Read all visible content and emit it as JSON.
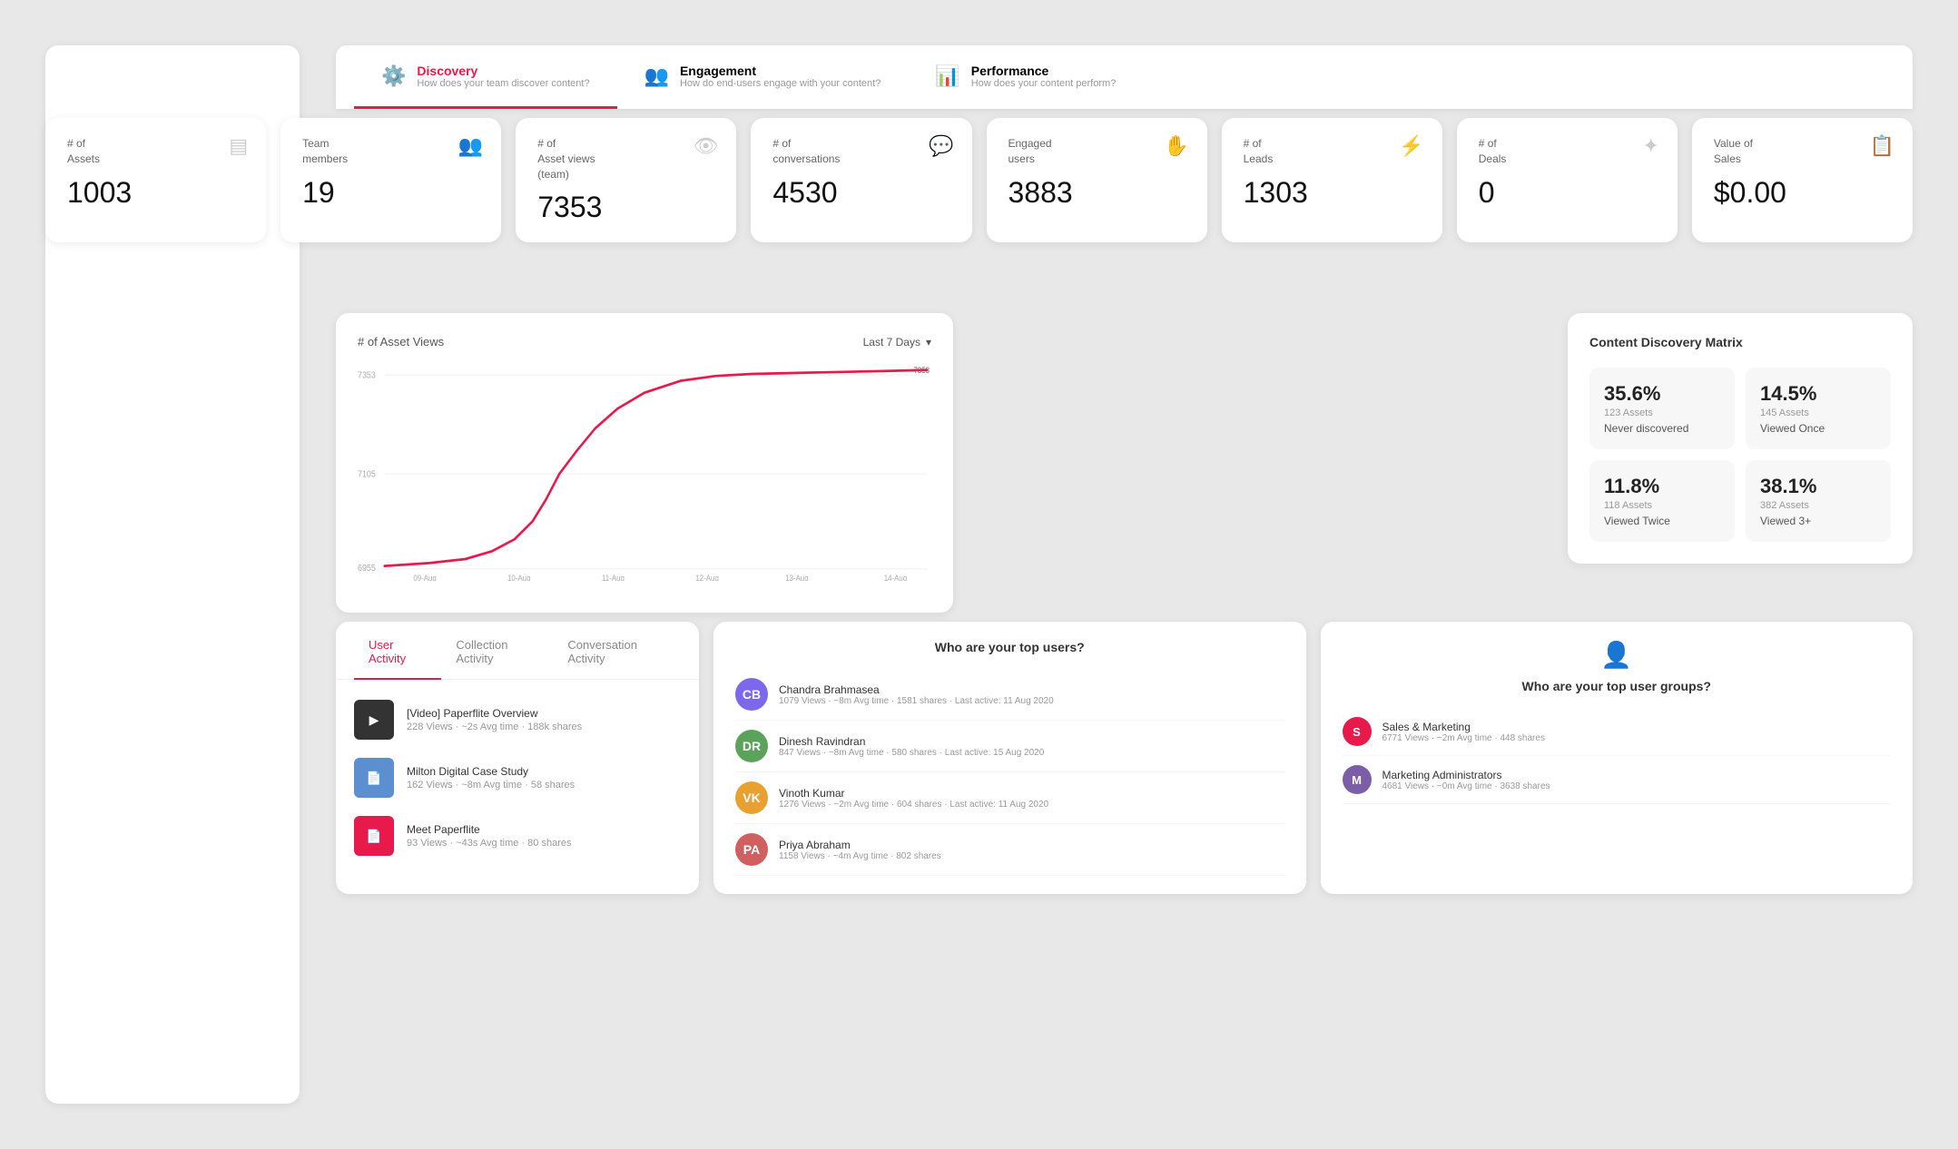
{
  "nav": {
    "tabs": [
      {
        "id": "discovery",
        "label": "Discovery",
        "sublabel": "How does your team discover content?",
        "active": true
      },
      {
        "id": "engagement",
        "label": "Engagement",
        "sublabel": "How do end-users engage with your content?",
        "active": false
      },
      {
        "id": "performance",
        "label": "Performance",
        "sublabel": "How does your content perform?",
        "active": false
      }
    ]
  },
  "metrics": [
    {
      "id": "assets",
      "label": "# of\nAssets",
      "value": "1003",
      "icon": "▤"
    },
    {
      "id": "team",
      "label": "Team\nmembers",
      "value": "19",
      "icon": "👥"
    },
    {
      "id": "asset-views",
      "label": "# of\nAsset views\n(team)",
      "value": "7353",
      "icon": "👁"
    },
    {
      "id": "conversations",
      "label": "# of\nconversations",
      "value": "4530",
      "icon": "💬"
    },
    {
      "id": "engaged-users",
      "label": "Engaged\nusers",
      "value": "3883",
      "icon": "✋"
    },
    {
      "id": "leads",
      "label": "# of\nLeads",
      "value": "1303",
      "icon": "⚡"
    },
    {
      "id": "deals",
      "label": "# of\nDeals",
      "value": "0",
      "icon": "✦"
    },
    {
      "id": "sales",
      "label": "Value of\nSales",
      "value": "$0.00",
      "icon": "📋"
    }
  ],
  "chart": {
    "title": "# of Asset Views",
    "period_label": "Last 7 Days",
    "y_max": "7353",
    "y_mid": "7105",
    "y_min": "6955",
    "x_labels": [
      "09-Aug",
      "10-Aug",
      "11-Aug",
      "12-Aug",
      "13-Aug",
      "14-Aug"
    ]
  },
  "discovery_matrix": {
    "title": "Content Discovery Matrix",
    "cells": [
      {
        "pct": "35.6%",
        "assets": "123 Assets",
        "desc": "Never discovered"
      },
      {
        "pct": "14.5%",
        "assets": "145 Assets",
        "desc": "Viewed Once"
      },
      {
        "pct": "11.8%",
        "assets": "118 Assets",
        "desc": "Viewed Twice"
      },
      {
        "pct": "38.1%",
        "assets": "382 Assets",
        "desc": "Viewed 3+"
      }
    ]
  },
  "activity": {
    "tabs": [
      "User Activity",
      "Collection Activity",
      "Conversation Activity"
    ],
    "active_tab": "User Activity",
    "items": [
      {
        "title": "[Video] Paperflite Overview",
        "meta": "228 Views · ~2s Avg time · 188k shares",
        "icon": "▶"
      },
      {
        "title": "Milton Digital Case Study",
        "meta": "162 Views · ~8m Avg time · 58 shares",
        "icon": "📄"
      },
      {
        "title": "Meet Paperflite",
        "meta": "93 Views · ~43s Avg time · 80 shares",
        "icon": "📄"
      }
    ]
  },
  "top_users": {
    "title": "Who are your top users?",
    "users": [
      {
        "name": "Chandra Brahmasea",
        "stats": "1079 Views · ~8m Avg time · 1581 shares · Last active: 11 Aug 2020",
        "initials": "CB",
        "color": "#7b68ee"
      },
      {
        "name": "Dinesh Ravindran",
        "stats": "847 Views · ~8m Avg time · 580 shares · Last active: 15 Aug 2020",
        "initials": "DR",
        "color": "#5ba35b"
      },
      {
        "name": "Vinoth Kumar",
        "stats": "1276 Views · ~2m Avg time · 604 shares · Last active: 11 Aug 2020",
        "initials": "VK",
        "color": "#e8a030"
      },
      {
        "name": "Priya Abraham",
        "stats": "1158 Views · ~4m Avg time · 802 shares",
        "initials": "PA",
        "color": "#d06060"
      }
    ]
  },
  "top_groups": {
    "title": "Who are your top user groups?",
    "icon": "👤",
    "groups": [
      {
        "name": "Sales & Marketing",
        "stats": "6771 Views · ~2m Avg time · 448 shares",
        "initial": "S",
        "color": "#e8194b"
      },
      {
        "name": "Marketing Administrators",
        "stats": "4681 Views · ~0m Avg time · 3638 shares",
        "initial": "M",
        "color": "#7b5ea7"
      }
    ]
  },
  "colors": {
    "accent": "#e8194b",
    "chart_line": "#e8194b",
    "bg": "#e8e8e8"
  }
}
